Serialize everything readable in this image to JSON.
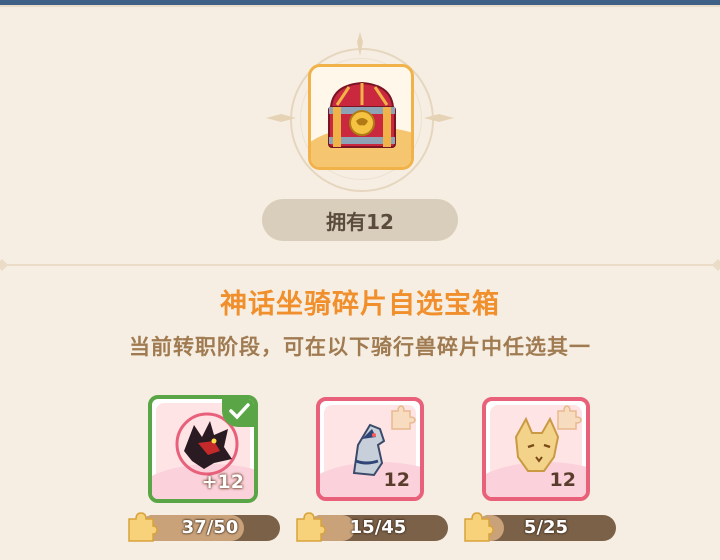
{
  "chest": {
    "icon": "treasure-chest-icon",
    "owned_label": "拥有12"
  },
  "header": {
    "title": "神话坐骑碎片自选宝箱",
    "subtitle": "当前转职阶段，可在以下骑行兽碎片中任选其一"
  },
  "items": [
    {
      "icon": "shadow-wolf-mount-icon",
      "count": "+12",
      "progress": "37/50",
      "current": 37,
      "max": 50,
      "selected": true
    },
    {
      "icon": "armored-horse-mount-icon",
      "count": "12",
      "progress": "15/45",
      "current": 15,
      "max": 45,
      "selected": false
    },
    {
      "icon": "golden-fox-mount-icon",
      "count": "12",
      "progress": "5/25",
      "current": 5,
      "max": 25,
      "selected": false
    }
  ],
  "colors": {
    "background": "#f6eee2",
    "title": "#f08f2c",
    "selected_border": "#5aa646",
    "card_border": "#e9607a",
    "progress_bar": "#7a6148"
  }
}
